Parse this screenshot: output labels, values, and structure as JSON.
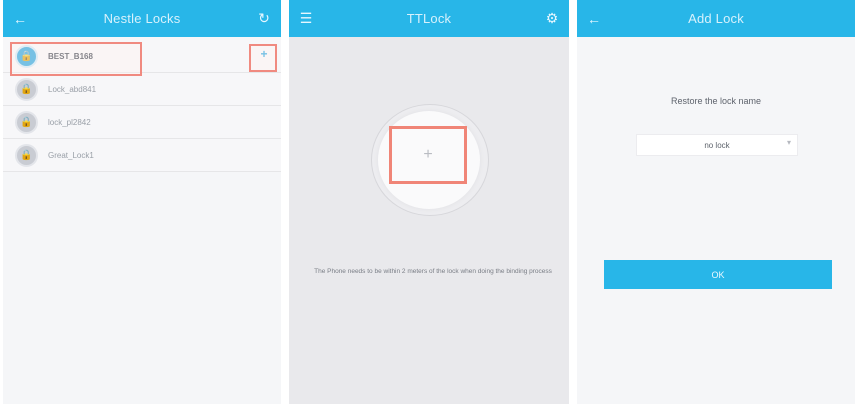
{
  "screen1": {
    "title": "Nestle Locks",
    "back_icon": "back-arrow-icon",
    "refresh_icon": "refresh-icon",
    "add_label": "+",
    "devices": [
      {
        "name": "BEST_B168",
        "icon": "lock-icon",
        "active": true
      },
      {
        "name": "Lock_abd841",
        "icon": "lock-icon",
        "active": false
      },
      {
        "name": "lock_pl2842",
        "icon": "lock-icon",
        "active": false
      },
      {
        "name": "Great_Lock1",
        "icon": "lock-icon",
        "active": false
      }
    ]
  },
  "screen2": {
    "title": "TTLock",
    "menu_icon": "menu-icon",
    "settings_icon": "settings-icon",
    "add_symbol": "+",
    "hint": "The Phone needs to be within 2 meters of the lock when doing the binding process"
  },
  "screen3": {
    "title": "Add Lock",
    "back_icon": "back-arrow-icon",
    "prompt": "Restore the lock name",
    "select_value": "no lock",
    "caret": "▾",
    "ok_label": "OK"
  }
}
